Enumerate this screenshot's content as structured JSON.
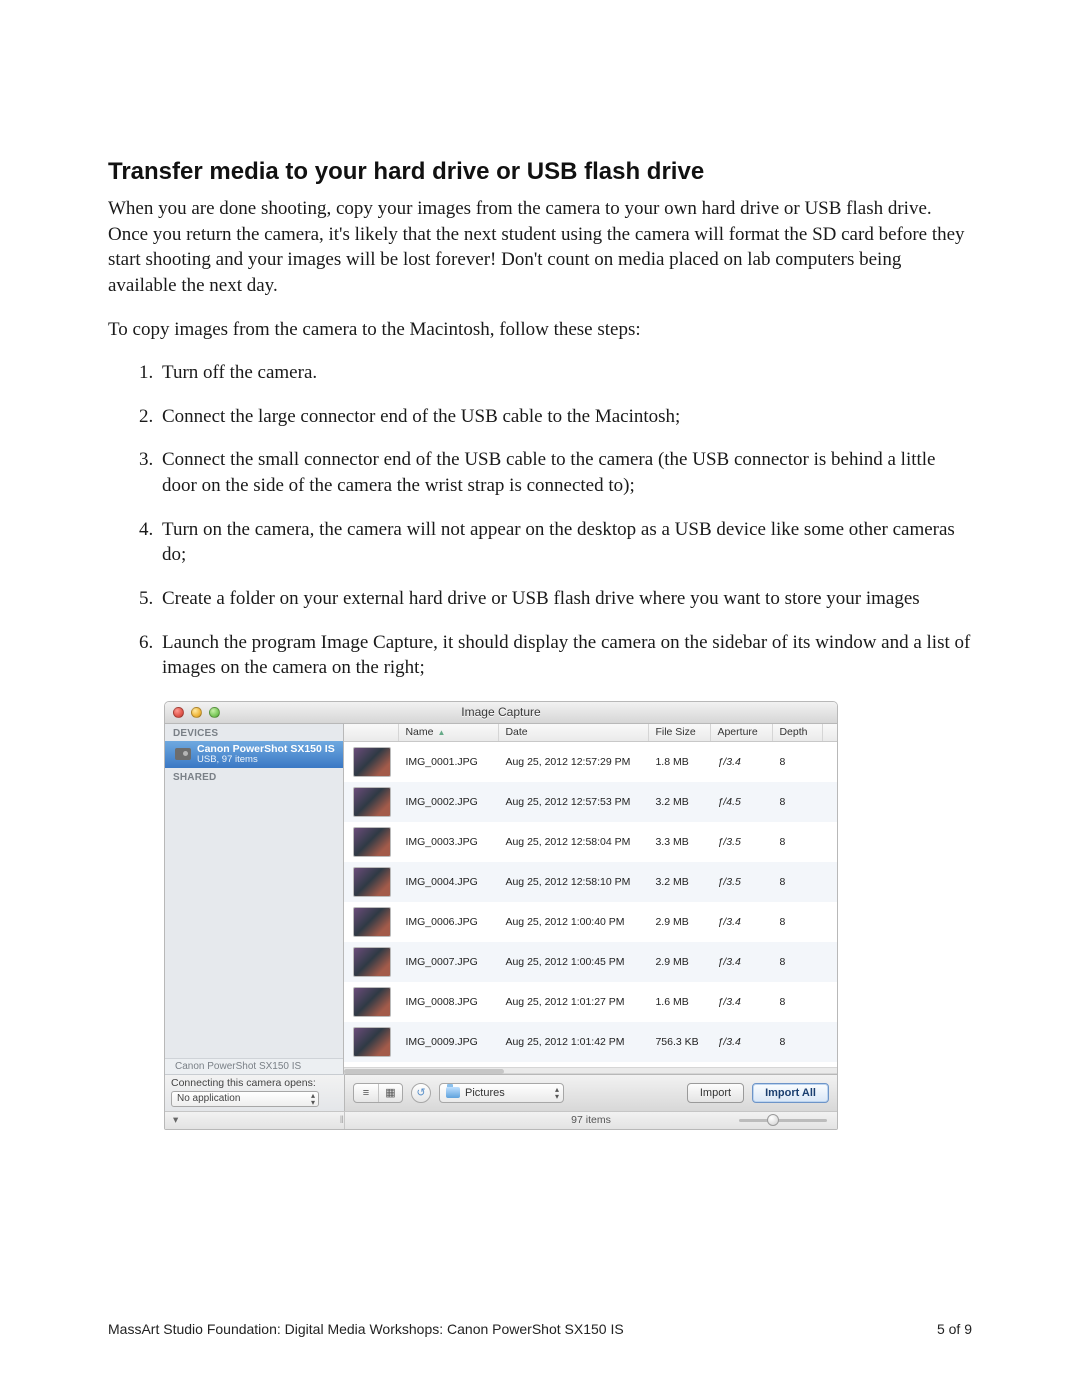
{
  "heading": "Transfer media to your hard drive or USB flash drive",
  "intro": "When you are done shooting, copy your images from the camera to your own hard drive or USB flash drive. Once you return the camera, it's likely that the next student using the camera will format the SD card before they start shooting and your images will be lost forever!  Don't count on media placed on lab computers being available the next day.",
  "lead": "To copy images from the camera to the Macintosh, follow these steps:",
  "steps": [
    "Turn off the camera.",
    "Connect the large connector end of the USB cable to the Macintosh;",
    "Connect the small connector end of the USB cable to the camera (the USB connector is behind a little door on the side of the camera the wrist strap is connected to);",
    "Turn on the camera, the camera will not appear on the desktop as a USB device like some other cameras do;",
    "Create a folder on your external hard drive or USB flash drive where you want to store your images",
    "Launch the program Image Capture, it should display the camera on the sidebar of its window and a list of images on the camera on the right;"
  ],
  "window": {
    "title": "Image Capture",
    "sidebar": {
      "devices_label": "DEVICES",
      "device_name": "Canon PowerShot SX150 IS",
      "device_sub": "USB, 97 items",
      "shared_label": "SHARED",
      "footer_device": "Canon PowerShot SX150 IS",
      "connect_label": "Connecting this camera opens:",
      "connect_value": "No application"
    },
    "columns": {
      "name": "Name",
      "date": "Date",
      "size": "File Size",
      "aperture": "Aperture",
      "depth": "Depth"
    },
    "rows": [
      {
        "name": "IMG_0001.JPG",
        "date": "Aug 25, 2012 12:57:29 PM",
        "size": "1.8 MB",
        "aperture": "ƒ/3.4",
        "depth": "8"
      },
      {
        "name": "IMG_0002.JPG",
        "date": "Aug 25, 2012 12:57:53 PM",
        "size": "3.2 MB",
        "aperture": "ƒ/4.5",
        "depth": "8"
      },
      {
        "name": "IMG_0003.JPG",
        "date": "Aug 25, 2012 12:58:04 PM",
        "size": "3.3 MB",
        "aperture": "ƒ/3.5",
        "depth": "8"
      },
      {
        "name": "IMG_0004.JPG",
        "date": "Aug 25, 2012 12:58:10 PM",
        "size": "3.2 MB",
        "aperture": "ƒ/3.5",
        "depth": "8"
      },
      {
        "name": "IMG_0006.JPG",
        "date": "Aug 25, 2012 1:00:40 PM",
        "size": "2.9 MB",
        "aperture": "ƒ/3.4",
        "depth": "8"
      },
      {
        "name": "IMG_0007.JPG",
        "date": "Aug 25, 2012 1:00:45 PM",
        "size": "2.9 MB",
        "aperture": "ƒ/3.4",
        "depth": "8"
      },
      {
        "name": "IMG_0008.JPG",
        "date": "Aug 25, 2012 1:01:27 PM",
        "size": "1.6 MB",
        "aperture": "ƒ/3.4",
        "depth": "8"
      },
      {
        "name": "IMG_0009.JPG",
        "date": "Aug 25, 2012 1:01:42 PM",
        "size": "756.3 KB",
        "aperture": "ƒ/3.4",
        "depth": "8"
      }
    ],
    "toolbar": {
      "destination": "Pictures",
      "import_label": "Import",
      "import_all_label": "Import All"
    },
    "status": {
      "count": "97 items"
    }
  },
  "footer": {
    "left": "MassArt Studio Foundation: Digital Media Workshops: Canon PowerShot SX150 IS",
    "right": "5 of 9"
  }
}
